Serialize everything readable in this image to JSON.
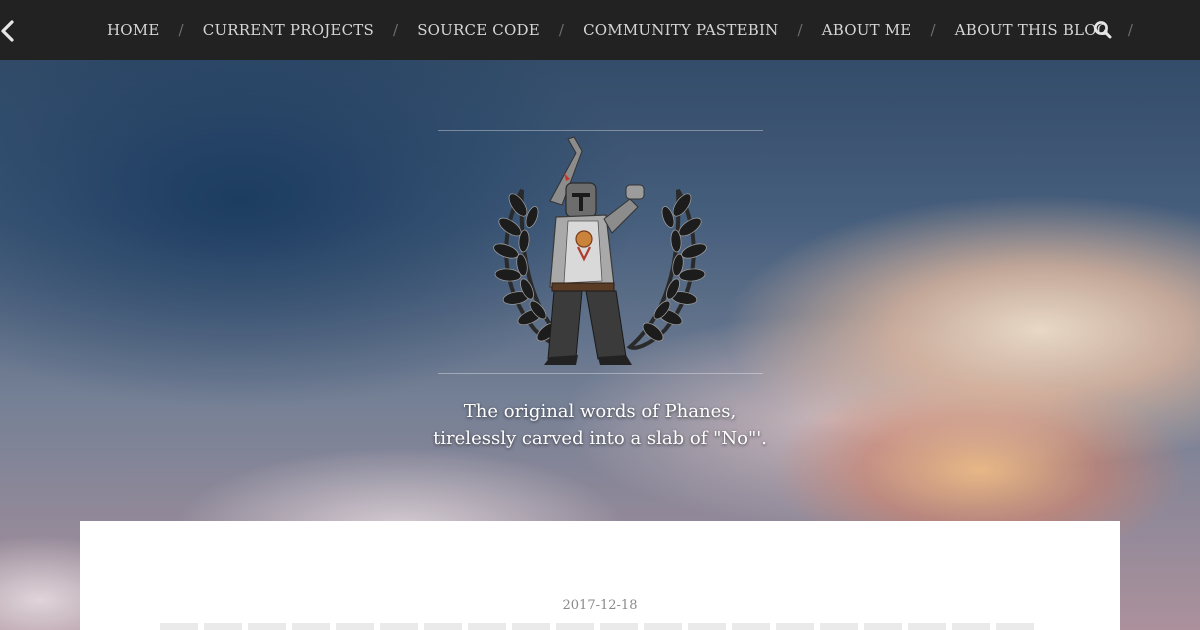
{
  "nav": {
    "items": [
      {
        "label": "HOME"
      },
      {
        "label": "CURRENT PROJECTS"
      },
      {
        "label": "SOURCE CODE"
      },
      {
        "label": "COMMUNITY PASTEBIN"
      },
      {
        "label": "ABOUT ME"
      },
      {
        "label": "ABOUT THIS BLOG"
      }
    ],
    "separator": "/",
    "back_icon": "chevron-left-icon",
    "search_icon": "search-icon"
  },
  "header": {
    "tagline_line1": "The original words of Phanes,",
    "tagline_line2": "tirelessly carved into a slab of \"No\"'.",
    "logo_icon": "knight-laurel-logo"
  },
  "post": {
    "date": "2017-12-18"
  },
  "colors": {
    "nav_bg": "#222222",
    "nav_text": "#d5d5d5",
    "card_bg": "#ffffff"
  }
}
